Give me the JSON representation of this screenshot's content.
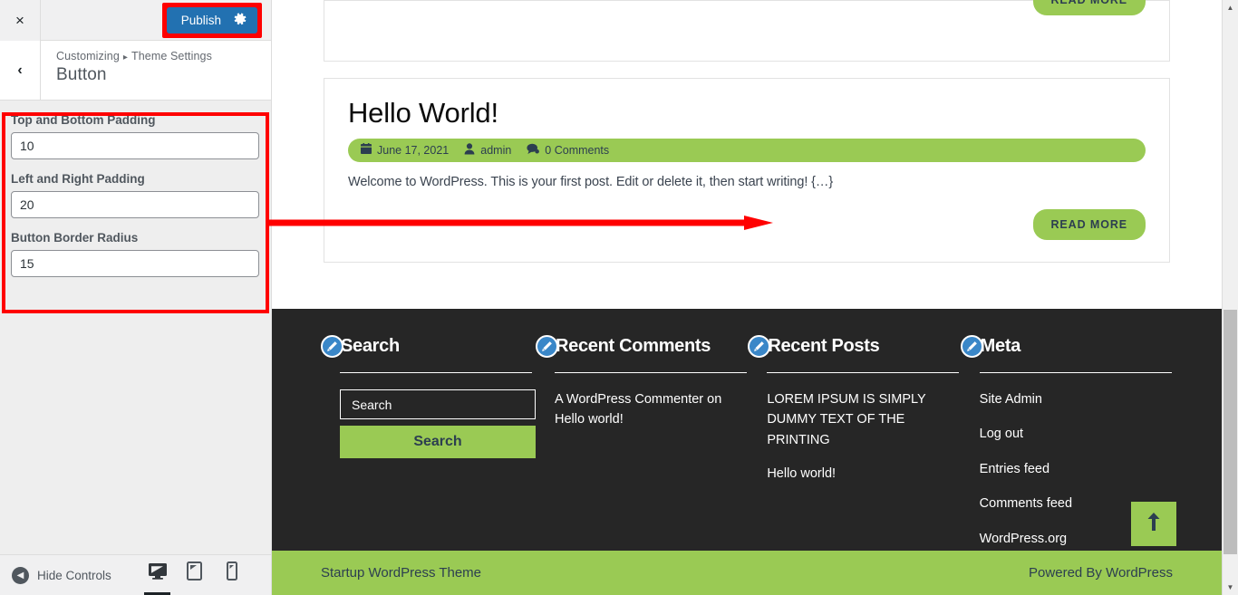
{
  "customizer": {
    "close_label": "×",
    "back_label": "‹",
    "publish_label": "Publish",
    "publish_gear_icon": "gear-icon",
    "breadcrumb_root": "Customizing",
    "breadcrumb_separator": "▸",
    "breadcrumb_section": "Theme Settings",
    "panel_title": "Button",
    "controls": [
      {
        "label": "Top and Bottom Padding",
        "value": "10",
        "name": "top-bottom-padding"
      },
      {
        "label": "Left and Right Padding",
        "value": "20",
        "name": "left-right-padding"
      },
      {
        "label": "Button Border Radius",
        "value": "15",
        "name": "button-border-radius"
      }
    ],
    "footer": {
      "hide_controls_label": "Hide Controls",
      "devices": [
        {
          "label": "Desktop",
          "icon": "desktop-icon",
          "active": true
        },
        {
          "label": "Tablet",
          "icon": "tablet-icon",
          "active": false
        },
        {
          "label": "Mobile",
          "icon": "mobile-icon",
          "active": false
        }
      ]
    }
  },
  "annotations": {
    "highlight_color": "#ff0000",
    "arrow_color": "#ff0000"
  },
  "preview": {
    "top_card": {
      "read_more_label": "READ MORE"
    },
    "post": {
      "title": "Hello World!",
      "date": "June 17, 2021",
      "author": "admin",
      "comments": "0 Comments",
      "excerpt": "Welcome to WordPress. This is your first post. Edit or delete it, then start writing! {…}",
      "read_more_label": "READ MORE"
    },
    "footer_widgets": [
      {
        "title": "Search",
        "type": "search",
        "search_placeholder": "Search",
        "search_button_label": "Search"
      },
      {
        "title": "Recent Comments",
        "type": "text",
        "items": [
          "A WordPress Commenter on Hello world!"
        ]
      },
      {
        "title": "Recent Posts",
        "type": "links",
        "items": [
          "LOREM IPSUM IS SIMPLY DUMMY TEXT OF THE PRINTING",
          "Hello world!"
        ]
      },
      {
        "title": "Meta",
        "type": "links",
        "items": [
          "Site Admin",
          "Log out",
          "Entries feed",
          "Comments feed",
          "WordPress.org"
        ]
      }
    ],
    "scroll_top_icon": "arrow-up-icon",
    "footer_bar": {
      "left": "Startup WordPress Theme",
      "right": "Powered By WordPress"
    }
  },
  "colors": {
    "theme_green": "#9ACA54",
    "footer_dark": "#262626",
    "publish_blue": "#2271b1",
    "badge_blue": "#3a87c8",
    "annotation_red": "#ff0000"
  }
}
